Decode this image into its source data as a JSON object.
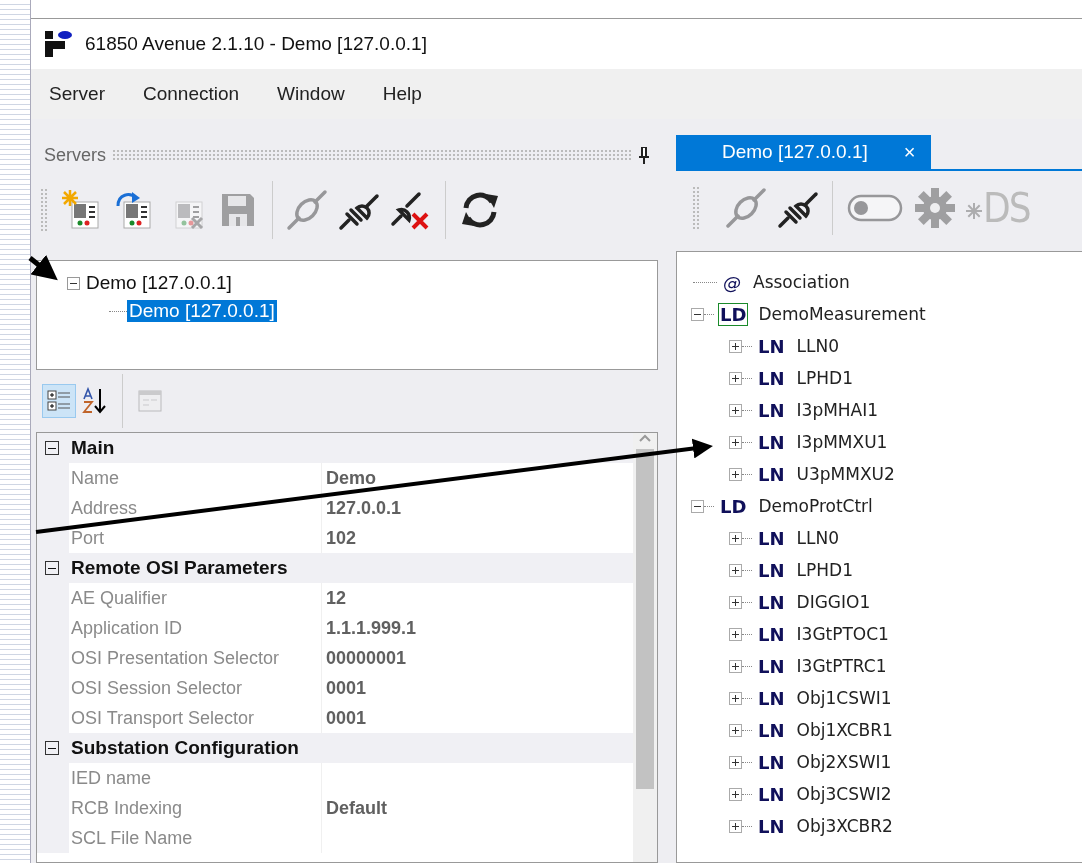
{
  "window": {
    "title": "61850 Avenue 2.1.10 - Demo [127.0.0.1]"
  },
  "menu": [
    "Server",
    "Connection",
    "Window",
    "Help"
  ],
  "servers_panel": {
    "title": "Servers",
    "toolbar": [
      [
        {
          "kind": "new-server",
          "disabled": false
        },
        {
          "kind": "open-server",
          "disabled": false
        },
        {
          "kind": "remove-server",
          "disabled": true
        },
        {
          "kind": "save",
          "disabled": true
        }
      ],
      [
        {
          "kind": "connect",
          "disabled": true
        },
        {
          "kind": "disconnect",
          "disabled": false
        },
        {
          "kind": "abort",
          "disabled": false
        }
      ],
      [
        {
          "kind": "refresh",
          "disabled": false
        }
      ]
    ],
    "tree": [
      {
        "label": "Demo [127.0.0.1]",
        "expanded": true,
        "selected": false,
        "children": [
          {
            "label": "Demo [127.0.0.1]",
            "selected": true
          }
        ]
      }
    ]
  },
  "properties": {
    "toolbar": [
      {
        "kind": "categorized",
        "selected": true,
        "disabled": false
      },
      {
        "kind": "alphabetical",
        "selected": false,
        "disabled": false
      },
      {
        "kind": "property-pages",
        "selected": false,
        "disabled": true
      }
    ],
    "categories": [
      {
        "name": "Main",
        "expanded": true,
        "rows": [
          {
            "name": "Name",
            "value": "Demo"
          },
          {
            "name": "Address",
            "value": "127.0.0.1"
          },
          {
            "name": "Port",
            "value": "102"
          }
        ]
      },
      {
        "name": "Remote OSI Parameters",
        "expanded": true,
        "rows": [
          {
            "name": "AE Qualifier",
            "value": "12"
          },
          {
            "name": "Application ID",
            "value": "1.1.1.999.1"
          },
          {
            "name": "OSI Presentation Selector",
            "value": "00000001"
          },
          {
            "name": "OSI Session Selector",
            "value": "0001"
          },
          {
            "name": "OSI Transport Selector",
            "value": "0001"
          }
        ]
      },
      {
        "name": "Substation Configuration",
        "expanded": true,
        "rows": [
          {
            "name": "IED name",
            "value": ""
          },
          {
            "name": "RCB Indexing",
            "value": "Default"
          },
          {
            "name": "SCL File Name",
            "value": ""
          }
        ]
      }
    ]
  },
  "document": {
    "tabs": [
      {
        "label": "Demo [127.0.0.1]",
        "close": "×",
        "selected": true
      }
    ],
    "toolbar": [
      {
        "kind": "connect",
        "disabled": true
      },
      {
        "kind": "disconnect",
        "disabled": false
      },
      {
        "kind": "toggle",
        "disabled": true
      },
      {
        "kind": "settings",
        "disabled": true
      },
      {
        "kind": "dataset",
        "label": "DS",
        "disabled": true
      }
    ],
    "tree": [
      {
        "kind": "association",
        "tag": "@",
        "label": "Association",
        "focused": false
      },
      {
        "kind": "ld",
        "tag": "LD",
        "label": "DemoMeasurement",
        "expanded": true,
        "focused": true,
        "children": [
          {
            "kind": "ln",
            "tag": "LN",
            "label": "LLN0",
            "expanded": false,
            "focused": false
          },
          {
            "kind": "ln",
            "tag": "LN",
            "label": "LPHD1",
            "expanded": false,
            "focused": false
          },
          {
            "kind": "ln",
            "tag": "LN",
            "label": "I3pMHAI1",
            "expanded": false,
            "focused": false
          },
          {
            "kind": "ln",
            "tag": "LN",
            "label": "I3pMMXU1",
            "expanded": false,
            "focused": false
          },
          {
            "kind": "ln",
            "tag": "LN",
            "label": "U3pMMXU2",
            "expanded": false,
            "focused": false
          }
        ]
      },
      {
        "kind": "ld",
        "tag": "LD",
        "label": "DemoProtCtrl",
        "expanded": true,
        "focused": false,
        "children": [
          {
            "kind": "ln",
            "tag": "LN",
            "label": "LLN0",
            "expanded": false,
            "focused": false
          },
          {
            "kind": "ln",
            "tag": "LN",
            "label": "LPHD1",
            "expanded": false,
            "focused": false
          },
          {
            "kind": "ln",
            "tag": "LN",
            "label": "DIGGIO1",
            "expanded": false,
            "focused": false
          },
          {
            "kind": "ln",
            "tag": "LN",
            "label": "I3GtPTOC1",
            "expanded": false,
            "focused": false
          },
          {
            "kind": "ln",
            "tag": "LN",
            "label": "I3GtPTRC1",
            "expanded": false,
            "focused": false
          },
          {
            "kind": "ln",
            "tag": "LN",
            "label": "Obj1CSWI1",
            "expanded": false,
            "focused": false
          },
          {
            "kind": "ln",
            "tag": "LN",
            "label": "Obj1XCBR1",
            "expanded": false,
            "focused": false
          },
          {
            "kind": "ln",
            "tag": "LN",
            "label": "Obj2XSWI1",
            "expanded": false,
            "focused": false
          },
          {
            "kind": "ln",
            "tag": "LN",
            "label": "Obj3CSWI2",
            "expanded": false,
            "focused": false
          },
          {
            "kind": "ln",
            "tag": "LN",
            "label": "Obj3XCBR2",
            "expanded": false,
            "focused": false
          }
        ]
      }
    ]
  }
}
